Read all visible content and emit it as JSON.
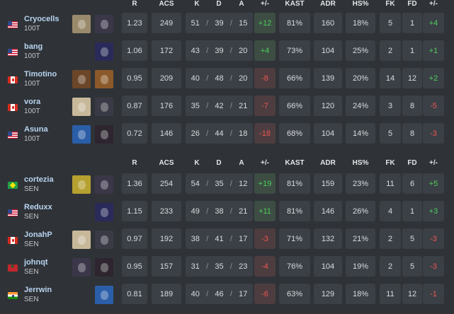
{
  "headers": {
    "r": "R",
    "acs": "ACS",
    "k": "K",
    "d": "D",
    "a": "A",
    "diff": "+/-",
    "kast": "KAST",
    "adr": "ADR",
    "hs": "HS%",
    "fk": "FK",
    "fd": "FD",
    "fkdiff": "+/-"
  },
  "kda_sep": "/",
  "colors": {
    "positive": "#4ecf59",
    "negative": "#ef5552",
    "player_name": "#b9d3f1",
    "cell_bg": "#3b4046"
  },
  "teams": [
    {
      "players": [
        {
          "name": "Cryocells",
          "team": "100T",
          "flag": "us-flag",
          "agents": [
            {
              "icon": "cypher-agent-icon",
              "color": "#9a8a6c"
            },
            {
              "icon": "fade-agent-icon",
              "color": "#3b3648"
            }
          ],
          "r": "1.23",
          "acs": "249",
          "k": "51",
          "d": "39",
          "a": "15",
          "diff": "+12",
          "kast": "81%",
          "adr": "160",
          "hs": "18%",
          "fk": "5",
          "fd": "1",
          "fkdiff": "+4"
        },
        {
          "name": "bang",
          "team": "100T",
          "flag": "us-flag",
          "agents": [
            {
              "icon": "omen-agent-icon",
              "color": "#2a2a5a"
            }
          ],
          "r": "1.06",
          "acs": "172",
          "k": "43",
          "d": "39",
          "a": "20",
          "diff": "+4",
          "kast": "73%",
          "adr": "104",
          "hs": "25%",
          "fk": "2",
          "fd": "1",
          "fkdiff": "+1"
        },
        {
          "name": "Timotino",
          "team": "100T",
          "flag": "ca-flag",
          "agents": [
            {
              "icon": "breach-agent-icon",
              "color": "#6b4628"
            },
            {
              "icon": "raze-agent-icon",
              "color": "#8c5a2a"
            }
          ],
          "r": "0.95",
          "acs": "209",
          "k": "40",
          "d": "48",
          "a": "20",
          "diff": "-8",
          "kast": "66%",
          "adr": "139",
          "hs": "20%",
          "fk": "14",
          "fd": "12",
          "fkdiff": "+2"
        },
        {
          "name": "vora",
          "team": "100T",
          "flag": "ca-flag",
          "agents": [
            {
              "icon": "sage-agent-icon",
              "color": "#c8b89a"
            },
            {
              "icon": "viper-agent-icon",
              "color": "#3a3a46"
            }
          ],
          "r": "0.87",
          "acs": "176",
          "k": "35",
          "d": "42",
          "a": "21",
          "diff": "-7",
          "kast": "66%",
          "adr": "120",
          "hs": "24%",
          "fk": "3",
          "fd": "8",
          "fkdiff": "-5"
        },
        {
          "name": "Asuna",
          "team": "100T",
          "flag": "us-flag",
          "agents": [
            {
              "icon": "neon-agent-icon",
              "color": "#2b5ea8"
            },
            {
              "icon": "reyna-agent-icon",
              "color": "#2e2530"
            }
          ],
          "r": "0.72",
          "acs": "146",
          "k": "26",
          "d": "44",
          "a": "18",
          "diff": "-18",
          "kast": "68%",
          "adr": "104",
          "hs": "14%",
          "fk": "5",
          "fd": "8",
          "fkdiff": "-3"
        }
      ]
    },
    {
      "players": [
        {
          "name": "cortezia",
          "team": "SEN",
          "flag": "br-flag",
          "agents": [
            {
              "icon": "killjoy-agent-icon",
              "color": "#b5a030"
            },
            {
              "icon": "fade-agent-icon",
              "color": "#3b3648"
            }
          ],
          "r": "1.36",
          "acs": "254",
          "k": "54",
          "d": "35",
          "a": "12",
          "diff": "+19",
          "kast": "81%",
          "adr": "159",
          "hs": "23%",
          "fk": "11",
          "fd": "6",
          "fkdiff": "+5"
        },
        {
          "name": "Reduxx",
          "team": "SEN",
          "flag": "us-flag",
          "agents": [
            {
              "icon": "omen-agent-icon",
              "color": "#2a2a5a"
            }
          ],
          "r": "1.15",
          "acs": "233",
          "k": "49",
          "d": "38",
          "a": "21",
          "diff": "+11",
          "kast": "81%",
          "adr": "146",
          "hs": "26%",
          "fk": "4",
          "fd": "1",
          "fkdiff": "+3"
        },
        {
          "name": "JonahP",
          "team": "SEN",
          "flag": "ca-flag",
          "agents": [
            {
              "icon": "sage-agent-icon",
              "color": "#c8b89a"
            },
            {
              "icon": "viper-agent-icon",
              "color": "#3a3a46"
            }
          ],
          "r": "0.97",
          "acs": "192",
          "k": "38",
          "d": "41",
          "a": "17",
          "diff": "-3",
          "kast": "71%",
          "adr": "132",
          "hs": "21%",
          "fk": "2",
          "fd": "5",
          "fkdiff": "-3"
        },
        {
          "name": "johnqt",
          "team": "SEN",
          "flag": "ma-flag",
          "agents": [
            {
              "icon": "fade-agent-icon",
              "color": "#3b3648"
            },
            {
              "icon": "reyna-agent-icon",
              "color": "#2e2530"
            }
          ],
          "r": "0.95",
          "acs": "157",
          "k": "31",
          "d": "35",
          "a": "23",
          "diff": "-4",
          "kast": "76%",
          "adr": "104",
          "hs": "19%",
          "fk": "2",
          "fd": "5",
          "fkdiff": "-3"
        },
        {
          "name": "Jerrwin",
          "team": "SEN",
          "flag": "in-flag",
          "agents": [
            {
              "icon": "neon-agent-icon",
              "color": "#2b5ea8"
            }
          ],
          "r": "0.81",
          "acs": "189",
          "k": "40",
          "d": "46",
          "a": "17",
          "diff": "-6",
          "kast": "63%",
          "adr": "129",
          "hs": "18%",
          "fk": "11",
          "fd": "12",
          "fkdiff": "-1"
        }
      ]
    }
  ]
}
